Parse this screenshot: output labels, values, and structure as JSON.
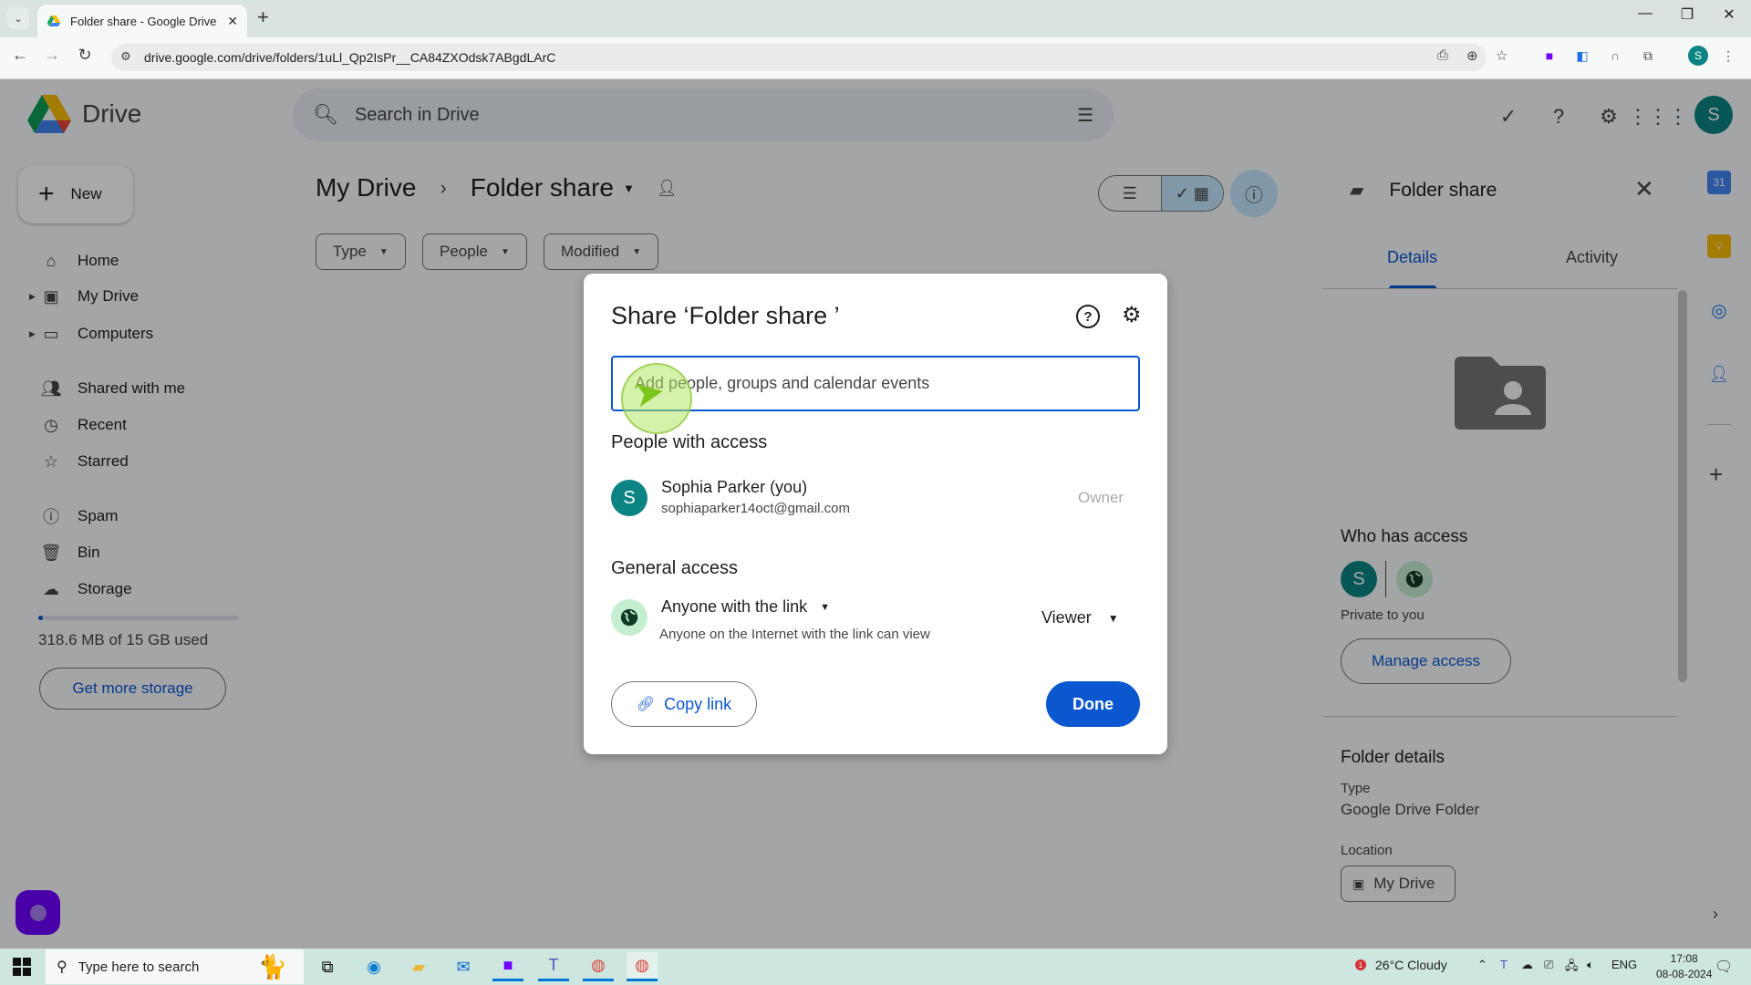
{
  "browser": {
    "tab_title": "Folder share - Google Drive",
    "url": "drive.google.com/drive/folders/1uLl_Qp2IsPr__CA84ZXOdsk7ABgdLArC",
    "profile_initial": "S"
  },
  "drive": {
    "app_name": "Drive",
    "search_placeholder": "Search in Drive",
    "account_initial": "S",
    "new_button": "New",
    "nav": [
      {
        "label": "Home",
        "icon": "home-icon"
      },
      {
        "label": "My Drive",
        "icon": "my-drive-icon"
      },
      {
        "label": "Computers",
        "icon": "computers-icon"
      },
      {
        "label": "Shared with me",
        "icon": "shared-icon"
      },
      {
        "label": "Recent",
        "icon": "clock-icon"
      },
      {
        "label": "Starred",
        "icon": "star-icon"
      },
      {
        "label": "Spam",
        "icon": "spam-icon"
      },
      {
        "label": "Bin",
        "icon": "bin-icon"
      },
      {
        "label": "Storage",
        "icon": "cloud-icon"
      }
    ],
    "storage": {
      "used_text": "318.6 MB of 15 GB used",
      "used_fraction": 0.021,
      "get_more_label": "Get more storage"
    },
    "breadcrumb": {
      "root": "My Drive",
      "current": "Folder share"
    },
    "filters": [
      "Type",
      "People",
      "Modified"
    ]
  },
  "details_panel": {
    "title": "Folder share",
    "tabs": [
      "Details",
      "Activity"
    ],
    "active_tab": "Details",
    "who_has_access_title": "Who has access",
    "owner_initial": "S",
    "access_summary": "Private to you",
    "manage_access_label": "Manage access",
    "folder_details_title": "Folder details",
    "type_label": "Type",
    "type_value": "Google Drive Folder",
    "location_label": "Location",
    "location_value": "My Drive"
  },
  "share_dialog": {
    "title": "Share ‘Folder share ’",
    "input_placeholder": "Add people, groups and calendar events",
    "input_value": "",
    "people_title": "People with access",
    "people": [
      {
        "initial": "S",
        "name": "Sophia Parker (you)",
        "email": "sophiaparker14oct@gmail.com",
        "role": "Owner"
      }
    ],
    "general_access_title": "General access",
    "general_access_scope": "Anyone with the link",
    "general_access_desc": "Anyone on the Internet with the link can view",
    "general_access_role": "Viewer",
    "copy_link_label": "Copy link",
    "done_label": "Done"
  },
  "taskbar": {
    "search_placeholder": "Type here to search",
    "weather_badge": "1",
    "weather": "26°C  Cloudy",
    "language": "ENG",
    "time": "17:08",
    "date": "08-08-2024"
  }
}
